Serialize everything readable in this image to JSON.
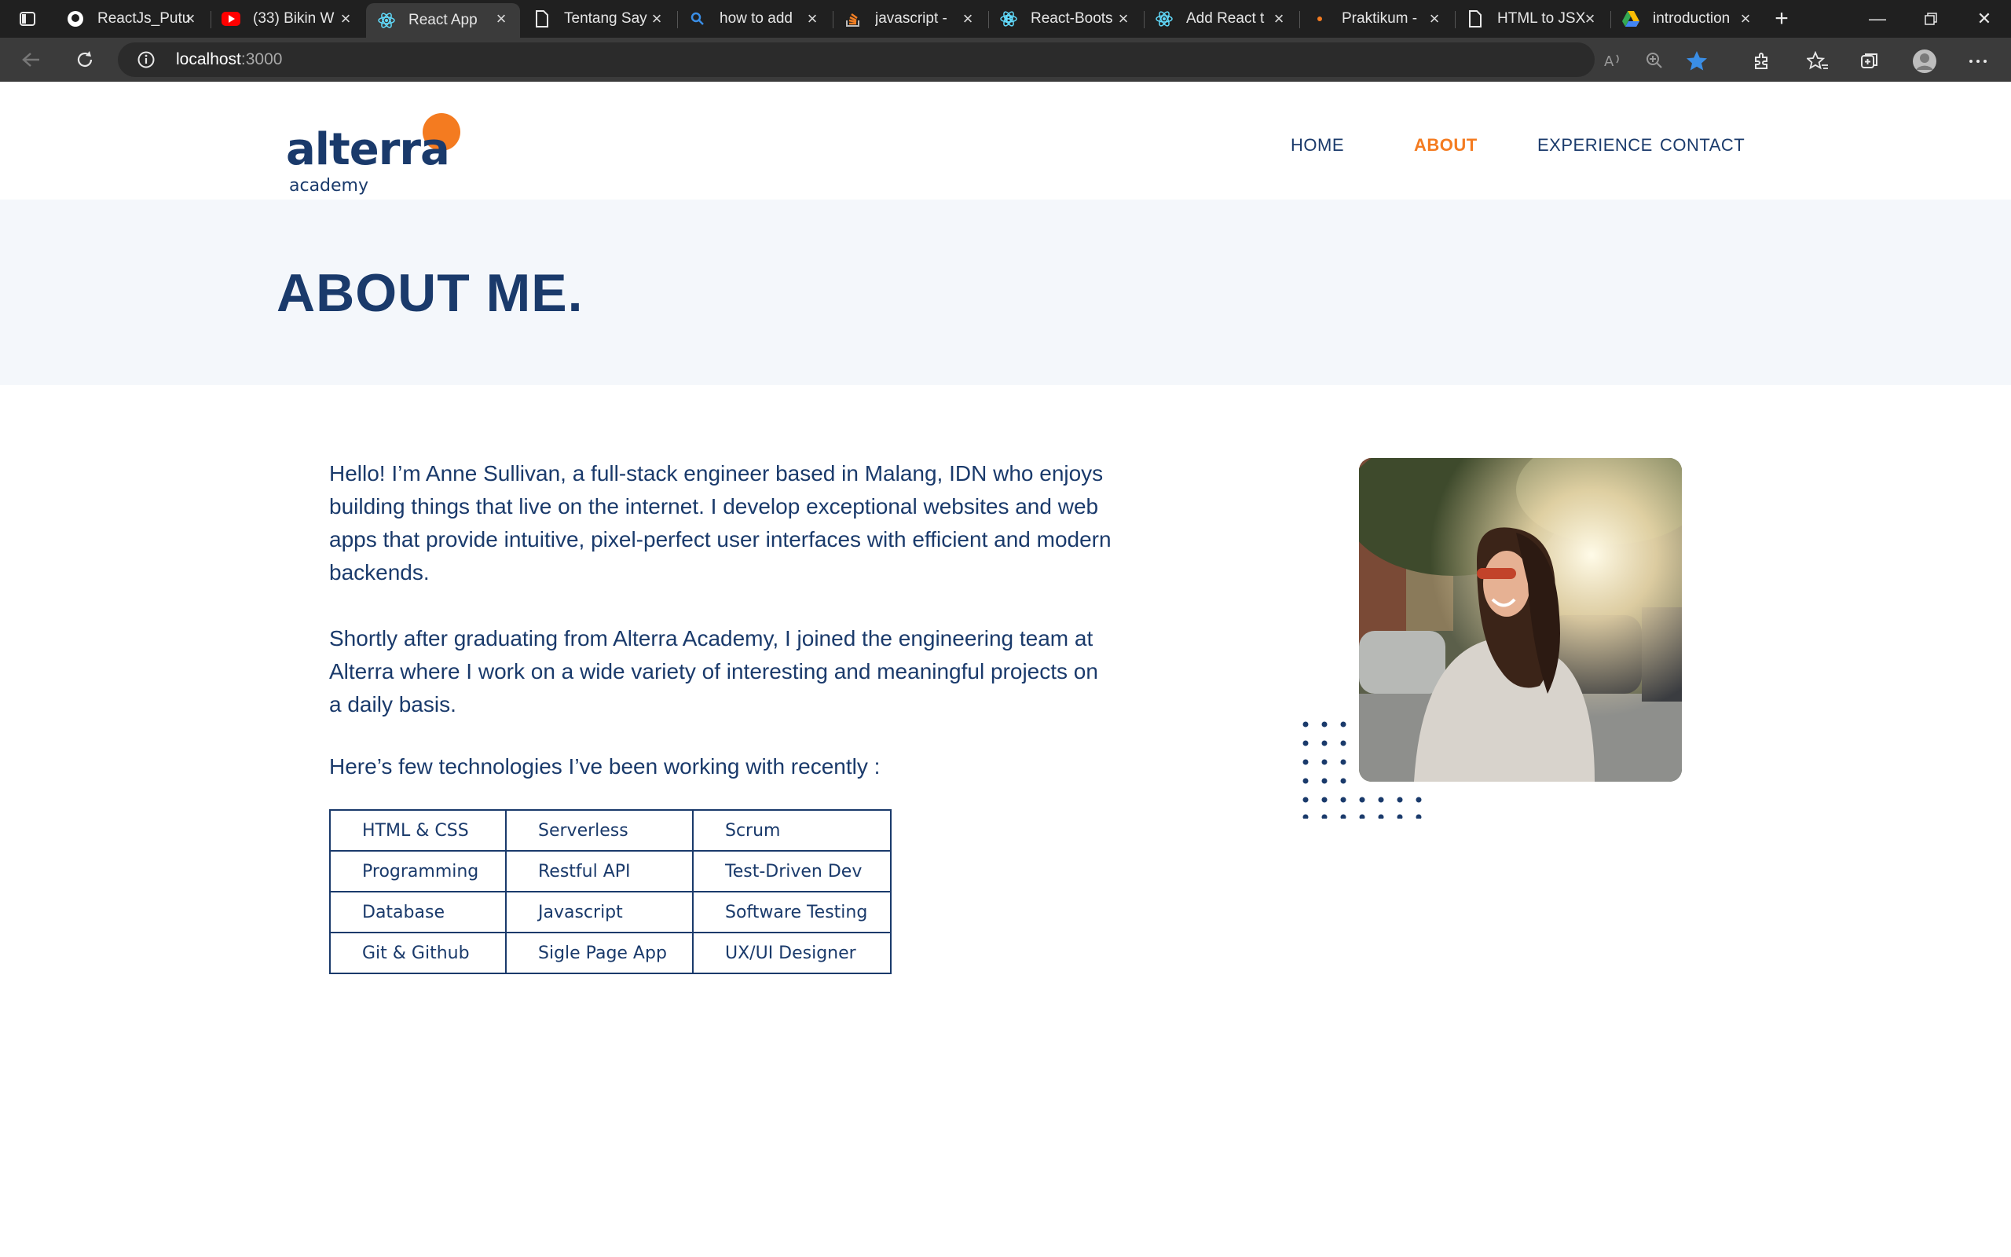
{
  "browser": {
    "tabs": [
      {
        "title": "ReactJs_Putu",
        "favicon": "github-icon"
      },
      {
        "title": "(33) Bikin W",
        "favicon": "youtube-icon"
      },
      {
        "title": "React App",
        "favicon": "react-icon",
        "active": true
      },
      {
        "title": "Tentang Say",
        "favicon": "document-icon"
      },
      {
        "title": "how to add",
        "favicon": "search-icon"
      },
      {
        "title": "javascript -",
        "favicon": "stackoverflow-icon"
      },
      {
        "title": "React-Boots",
        "favicon": "bootstrap-icon"
      },
      {
        "title": "Add React t",
        "favicon": "react-icon"
      },
      {
        "title": "Praktikum -",
        "favicon": "dot-icon"
      },
      {
        "title": "HTML to JSX",
        "favicon": "document-icon"
      },
      {
        "title": "introduction",
        "favicon": "drive-icon"
      }
    ],
    "url_host": "localhost",
    "url_port": ":3000"
  },
  "site": {
    "logo_word": "alterra",
    "logo_sub": "academy",
    "nav": {
      "home": "HOME",
      "about": "ABOUT",
      "experience": "EXPERIENCE",
      "contact": "CONTACT"
    },
    "accent_color": "#f47b20",
    "primary_color": "#1a3a6b"
  },
  "hero": {
    "title": "ABOUT ME."
  },
  "about": {
    "paragraph1": "Hello! I’m Anne Sullivan, a full-stack engineer based in Malang, IDN who enjoys building things that live on the internet. I develop exceptional websites and web apps that provide intuitive, pixel-perfect user interfaces with efficient and modern backends.",
    "paragraph2": "Shortly after graduating from Alterra Academy, I joined the engineering team at Alterra where I work on a wide variety of interesting and meaningful projects on a daily basis.",
    "tech_intro": "Here’s few technologies I’ve been working with recently :",
    "tech_table": [
      [
        "HTML & CSS",
        "Serverless",
        "Scrum"
      ],
      [
        "Programming",
        "Restful API",
        "Test-Driven Dev"
      ],
      [
        "Database",
        "Javascript",
        "Software Testing"
      ],
      [
        "Git & Github",
        "Sigle Page App",
        "UX/UI Designer"
      ]
    ]
  }
}
